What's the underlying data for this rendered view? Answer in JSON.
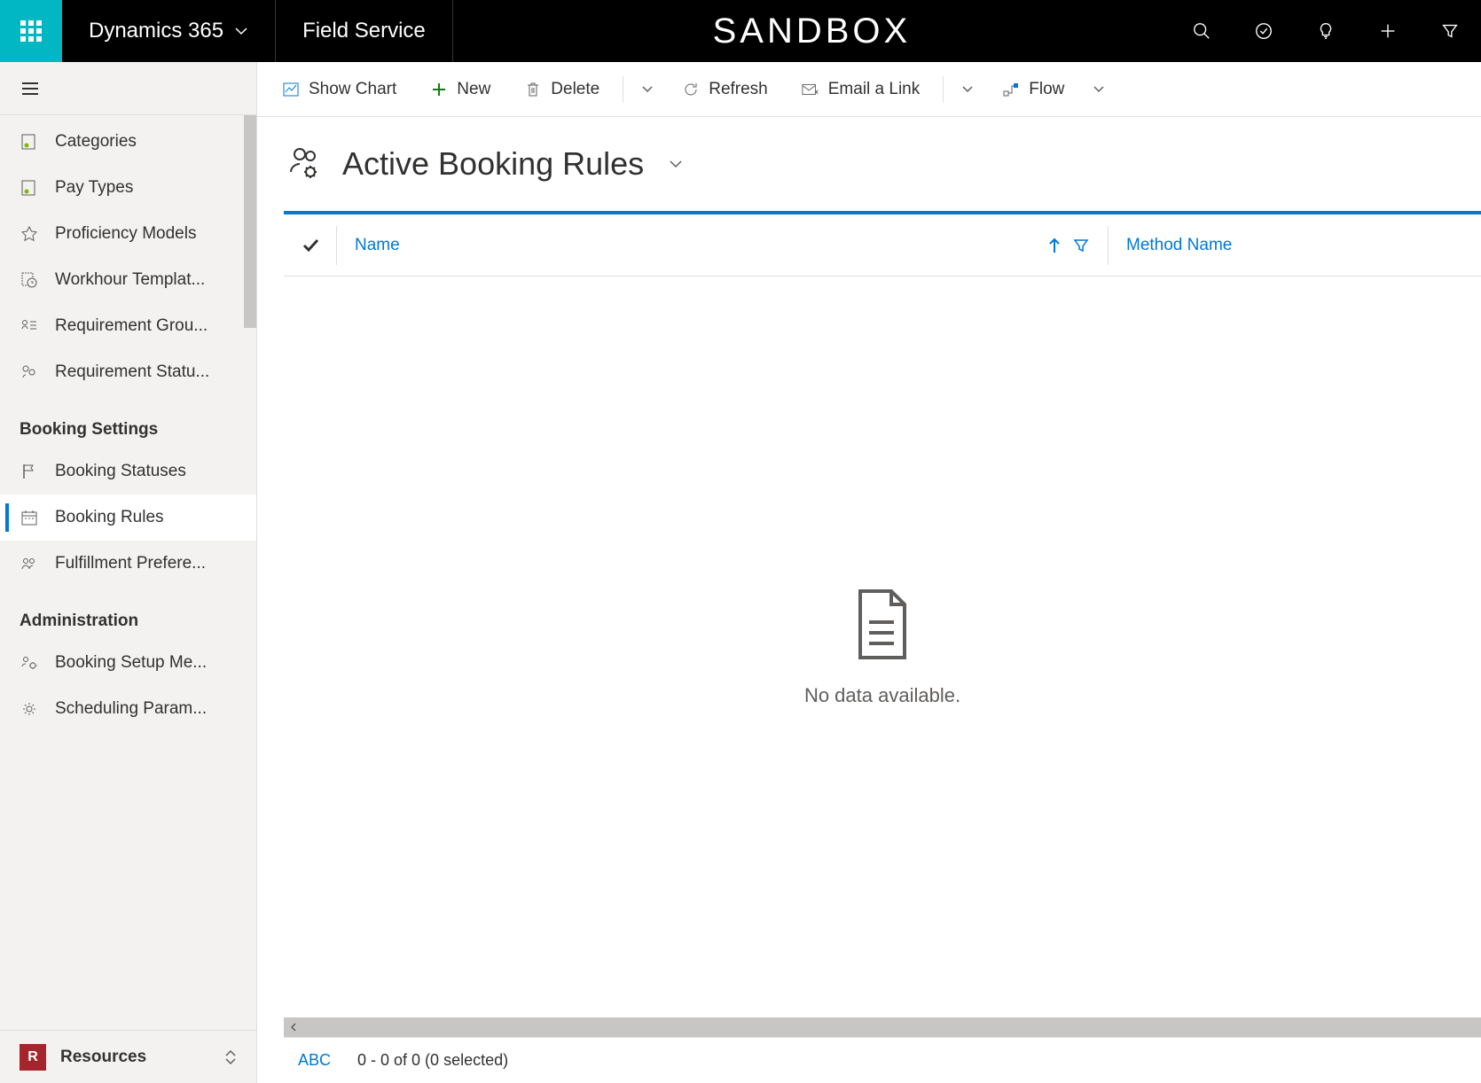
{
  "header": {
    "app_name": "Dynamics 365",
    "module": "Field Service",
    "env_label": "SANDBOX"
  },
  "sidebar": {
    "items": [
      {
        "label": "Categories",
        "icon": "category-icon",
        "active": false
      },
      {
        "label": "Pay Types",
        "icon": "paytype-icon",
        "active": false
      },
      {
        "label": "Proficiency Models",
        "icon": "star-icon",
        "active": false
      },
      {
        "label": "Workhour Templat...",
        "icon": "clock-doc-icon",
        "active": false
      },
      {
        "label": "Requirement Grou...",
        "icon": "req-group-icon",
        "active": false
      },
      {
        "label": "Requirement Statu...",
        "icon": "req-status-icon",
        "active": false
      }
    ],
    "group1_label": "Booking Settings",
    "group1_items": [
      {
        "label": "Booking Statuses",
        "icon": "flag-icon",
        "active": false
      },
      {
        "label": "Booking Rules",
        "icon": "calendar-icon",
        "active": true
      },
      {
        "label": "Fulfillment Prefere...",
        "icon": "people-icon",
        "active": false
      }
    ],
    "group2_label": "Administration",
    "group2_items": [
      {
        "label": "Booking Setup Me...",
        "icon": "gear-people-icon",
        "active": false
      },
      {
        "label": "Scheduling Param...",
        "icon": "gear-icon",
        "active": false
      }
    ],
    "footer_badge": "R",
    "footer_label": "Resources"
  },
  "commandbar": {
    "show_chart": "Show Chart",
    "new": "New",
    "delete": "Delete",
    "refresh": "Refresh",
    "email_link": "Email a Link",
    "flow": "Flow"
  },
  "view": {
    "title": "Active Booking Rules"
  },
  "grid": {
    "col1": "Name",
    "col2": "Method Name",
    "empty_msg": "No data available.",
    "abc": "ABC",
    "footer_count": "0 - 0 of 0 (0 selected)"
  }
}
